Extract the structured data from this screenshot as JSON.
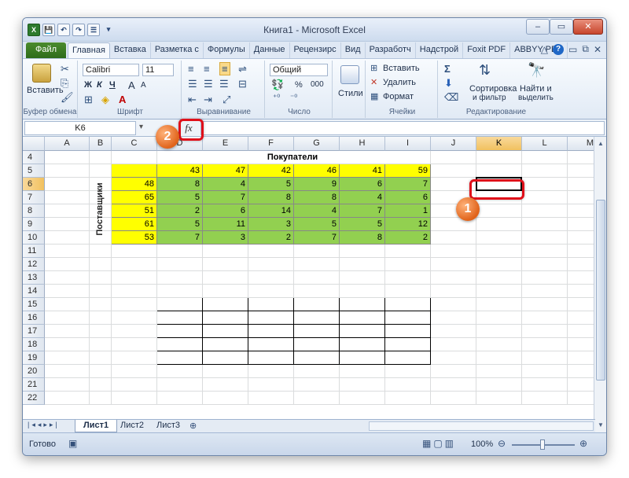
{
  "window": {
    "title": "Книга1 - Microsoft Excel",
    "minimize": "–",
    "restore": "▭",
    "close": "✕"
  },
  "qat": [
    "X",
    "💾",
    "↶",
    "↷",
    "☰",
    "▾"
  ],
  "menu": {
    "tabs": [
      "Файл",
      "Главная",
      "Вставка",
      "Разметка с",
      "Формулы",
      "Данные",
      "Рецензирс",
      "Вид",
      "Разработч",
      "Надстрой",
      "Foxit PDF",
      "ABBYY PDF"
    ],
    "active": "Главная"
  },
  "ribbon": {
    "clipboard": {
      "paste": "Вставить",
      "label": "Буфер обмена"
    },
    "font": {
      "name": "Calibri",
      "size": "11",
      "bold": "Ж",
      "italic": "К",
      "underline": "Ч",
      "grow": "A",
      "shrink": "A",
      "label": "Шрифт"
    },
    "alignment": {
      "label": "Выравнивание"
    },
    "number": {
      "format": "Общий",
      "percent": "%",
      "thousands": "000",
      "label": "Число"
    },
    "styles": {
      "btn": "Стили"
    },
    "cells": {
      "insert": "Вставить",
      "delete": "Удалить",
      "format": "Формат",
      "label": "Ячейки"
    },
    "editing": {
      "sort": "Сортировка",
      "sort2": "и фильтр",
      "find": "Найти и",
      "find2": "выделить",
      "label": "Редактирование"
    }
  },
  "formula_bar": {
    "namebox": "K6",
    "fx": "fx",
    "value": ""
  },
  "columns": [
    "A",
    "B",
    "C",
    "D",
    "E",
    "F",
    "G",
    "H",
    "I",
    "J",
    "K",
    "L",
    "M"
  ],
  "rows": [
    "4",
    "5",
    "6",
    "7",
    "8",
    "9",
    "10",
    "11",
    "12",
    "13",
    "14",
    "15",
    "16",
    "17",
    "18",
    "19",
    "20",
    "21",
    "22"
  ],
  "sheet": {
    "buyers_label": "Покупатели",
    "suppliers_label": "Поставщики",
    "header_row": [
      "43",
      "47",
      "42",
      "46",
      "41",
      "59"
    ],
    "supplier_values": [
      "48",
      "65",
      "51",
      "61",
      "53"
    ],
    "matrix": [
      [
        "8",
        "4",
        "5",
        "9",
        "6",
        "7"
      ],
      [
        "5",
        "7",
        "8",
        "8",
        "4",
        "6"
      ],
      [
        "2",
        "6",
        "14",
        "4",
        "7",
        "1"
      ],
      [
        "5",
        "11",
        "3",
        "5",
        "5",
        "12"
      ],
      [
        "7",
        "3",
        "2",
        "7",
        "8",
        "2"
      ]
    ]
  },
  "sheet_tabs": [
    "Лист1",
    "Лист2",
    "Лист3"
  ],
  "status": {
    "ready": "Готово",
    "zoom": "100%"
  },
  "callouts": [
    "1",
    "2"
  ]
}
